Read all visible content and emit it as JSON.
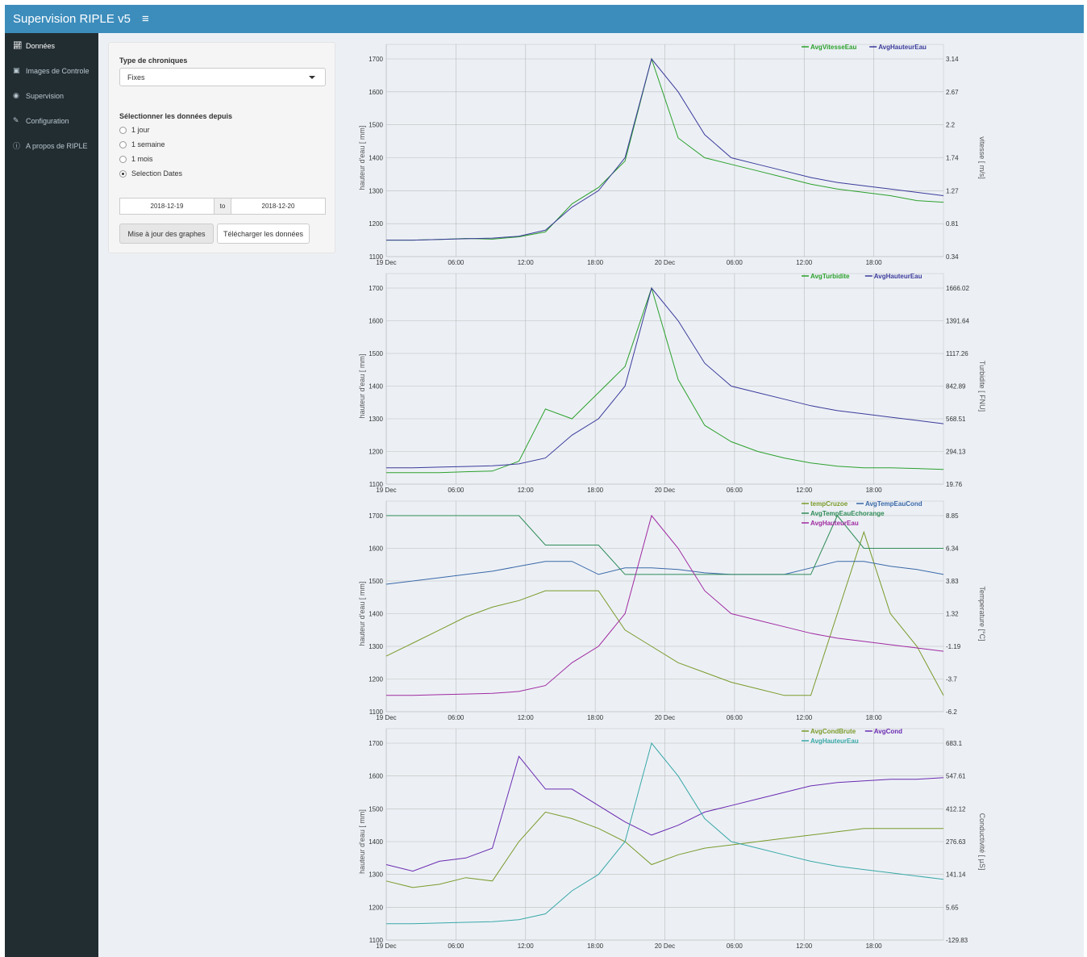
{
  "header": {
    "title": "Supervision RIPLE v5",
    "menu_icon": "hamburger-icon"
  },
  "sidebar": {
    "items": [
      {
        "label": "Données",
        "icon": "line-chart-icon",
        "active": true
      },
      {
        "label": "Images de Controle",
        "icon": "image-icon",
        "active": false
      },
      {
        "label": "Supervision",
        "icon": "dashboard-icon",
        "active": false
      },
      {
        "label": "Configuration",
        "icon": "edit-icon",
        "active": false
      },
      {
        "label": "A propos de RIPLE",
        "icon": "info-icon",
        "active": false
      }
    ]
  },
  "controls": {
    "type_label": "Type de chroniques",
    "type_value": "Fixes",
    "range_label": "Sélectionner les données depuis",
    "radio_options": [
      "1 jour",
      "1 semaine",
      "1 mois",
      "Selection Dates"
    ],
    "radio_selected": 3,
    "date_start": "2018-12-19",
    "date_sep": "to",
    "date_end": "2018-12-20",
    "update_button": "Mise à jour des graphes",
    "download_button": "Télécharger les données"
  },
  "colors": {
    "header": "#3c8dbc",
    "sidebar": "#222d32",
    "green": "#2ca02c",
    "navy": "#3b3b9a",
    "olive": "#7a9a2a",
    "teal": "#2e8b57",
    "blue": "#3a68a8",
    "magenta": "#a02aa0",
    "purple": "#6a2ab0",
    "cyan": "#3aa8a8"
  },
  "chart_data": [
    {
      "type": "line",
      "x_ticks": [
        "19 Dec",
        "06:00",
        "12:00",
        "18:00",
        "20 Dec",
        "06:00",
        "12:00",
        "18:00"
      ],
      "ylabel": "hauteur d'eau [ mm]",
      "ylim": [
        1100,
        1700
      ],
      "y_ticks": [
        "1100",
        "1200",
        "1300",
        "1400",
        "1500",
        "1600",
        "1700"
      ],
      "y2label": "vitesse [ m/s]",
      "y2_ticks": [
        "0.34",
        "0.81",
        "1.27",
        "1.74",
        "2.2",
        "2.67",
        "3.14"
      ],
      "series": [
        {
          "name": "AvgVitesseEau",
          "color": "#2ca02c",
          "values": [
            1150,
            1150,
            1152,
            1155,
            1153,
            1160,
            1175,
            1260,
            1310,
            1390,
            1700,
            1460,
            1400,
            1380,
            1360,
            1340,
            1320,
            1305,
            1295,
            1285,
            1270,
            1265
          ]
        },
        {
          "name": "AvgHauteurEau",
          "color": "#3b3b9a",
          "values": [
            1150,
            1150,
            1152,
            1154,
            1156,
            1162,
            1180,
            1250,
            1300,
            1400,
            1700,
            1600,
            1470,
            1400,
            1380,
            1360,
            1340,
            1325,
            1315,
            1305,
            1295,
            1285
          ]
        }
      ]
    },
    {
      "type": "line",
      "x_ticks": [
        "19 Dec",
        "06:00",
        "12:00",
        "18:00",
        "20 Dec",
        "06:00",
        "12:00",
        "18:00"
      ],
      "ylabel": "hauteur d'eau [ mm]",
      "ylim": [
        1100,
        1700
      ],
      "y_ticks": [
        "1100",
        "1200",
        "1300",
        "1400",
        "1500",
        "1600",
        "1700"
      ],
      "y2label": "Turbidite [ FNU]",
      "y2_ticks": [
        "19.76",
        "294.13",
        "568.51",
        "842.89",
        "1117.26",
        "1391.64",
        "1666.02"
      ],
      "series": [
        {
          "name": "AvgTurbidite",
          "color": "#2ca02c",
          "values": [
            1135,
            1135,
            1135,
            1138,
            1140,
            1170,
            1330,
            1300,
            1380,
            1460,
            1700,
            1420,
            1280,
            1230,
            1200,
            1180,
            1165,
            1155,
            1150,
            1150,
            1148,
            1145
          ]
        },
        {
          "name": "AvgHauteurEau",
          "color": "#3b3b9a",
          "values": [
            1150,
            1150,
            1152,
            1154,
            1156,
            1162,
            1180,
            1250,
            1300,
            1400,
            1700,
            1600,
            1470,
            1400,
            1380,
            1360,
            1340,
            1325,
            1315,
            1305,
            1295,
            1285
          ]
        }
      ]
    },
    {
      "type": "line",
      "x_ticks": [
        "19 Dec",
        "06:00",
        "12:00",
        "18:00",
        "20 Dec",
        "06:00",
        "12:00",
        "18:00"
      ],
      "ylabel": "hauteur d'eau [ mm]",
      "ylim": [
        1100,
        1700
      ],
      "y_ticks": [
        "1100",
        "1200",
        "1300",
        "1400",
        "1500",
        "1600",
        "1700"
      ],
      "y2label": "Temperature [°C]",
      "y2_ticks": [
        "-6.2",
        "-3.7",
        "-1.19",
        "1.32",
        "3.83",
        "6.34",
        "8.85"
      ],
      "series": [
        {
          "name": "tempCruzoe",
          "color": "#7a9a2a",
          "values": [
            1270,
            1310,
            1350,
            1390,
            1420,
            1440,
            1470,
            1470,
            1470,
            1350,
            1300,
            1250,
            1220,
            1190,
            1170,
            1150,
            1150,
            1400,
            1650,
            1400,
            1300,
            1150
          ]
        },
        {
          "name": "AvgTempEauCond",
          "color": "#3a68a8",
          "values": [
            1490,
            1500,
            1510,
            1520,
            1530,
            1545,
            1560,
            1560,
            1520,
            1540,
            1540,
            1535,
            1525,
            1520,
            1520,
            1520,
            1540,
            1560,
            1560,
            1545,
            1535,
            1520
          ]
        },
        {
          "name": "AvgTempEauEchorange",
          "color": "#2e8b57",
          "values": [
            1700,
            1700,
            1700,
            1700,
            1700,
            1700,
            1610,
            1610,
            1610,
            1520,
            1520,
            1520,
            1520,
            1520,
            1520,
            1520,
            1520,
            1700,
            1600,
            1600,
            1600,
            1600
          ]
        },
        {
          "name": "AvgHauteurEau",
          "color": "#a02aa0",
          "values": [
            1150,
            1150,
            1152,
            1154,
            1156,
            1162,
            1180,
            1250,
            1300,
            1400,
            1700,
            1600,
            1470,
            1400,
            1380,
            1360,
            1340,
            1325,
            1315,
            1305,
            1295,
            1285
          ]
        }
      ]
    },
    {
      "type": "line",
      "x_ticks": [
        "19 Dec",
        "06:00",
        "12:00",
        "18:00",
        "20 Dec",
        "06:00",
        "12:00",
        "18:00"
      ],
      "ylabel": "hauteur d'eau [ mm]",
      "ylim": [
        1100,
        1700
      ],
      "y_ticks": [
        "1100",
        "1200",
        "1300",
        "1400",
        "1500",
        "1600",
        "1700"
      ],
      "y2label": "Conductivité [ µS]",
      "y2_ticks": [
        "-129.83",
        "5.65",
        "141.14",
        "276.63",
        "412.12",
        "547.61",
        "683.1"
      ],
      "series": [
        {
          "name": "AvgCondBrute",
          "color": "#7a9a2a",
          "values": [
            1280,
            1260,
            1270,
            1290,
            1280,
            1400,
            1490,
            1470,
            1440,
            1400,
            1330,
            1360,
            1380,
            1390,
            1400,
            1410,
            1420,
            1430,
            1440,
            1440,
            1440,
            1440
          ]
        },
        {
          "name": "AvgCond",
          "color": "#6a2ab0",
          "values": [
            1330,
            1310,
            1340,
            1350,
            1380,
            1660,
            1560,
            1560,
            1510,
            1460,
            1420,
            1450,
            1490,
            1510,
            1530,
            1550,
            1570,
            1580,
            1585,
            1590,
            1590,
            1595
          ]
        },
        {
          "name": "AvgHauteurEau",
          "color": "#3aa8a8",
          "values": [
            1150,
            1150,
            1152,
            1154,
            1156,
            1162,
            1180,
            1250,
            1300,
            1400,
            1700,
            1600,
            1470,
            1400,
            1380,
            1360,
            1340,
            1325,
            1315,
            1305,
            1295,
            1285
          ]
        }
      ]
    }
  ]
}
